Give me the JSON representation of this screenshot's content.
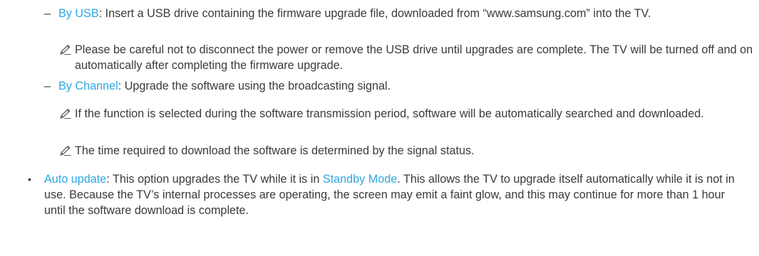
{
  "usb": {
    "dash": "–",
    "link": "By USB",
    "text": ": Insert a USB drive containing the firmware upgrade file, downloaded from “www.samsung.com” into the TV."
  },
  "notes": [
    "Please be careful not to disconnect the power or remove the USB drive until upgrades are complete. The TV will be turned off and on automatically after completing the firmware upgrade.",
    "If the function is selected during the software transmission period, software will be automatically searched and downloaded.",
    "The time required to download the software is determined by the signal status."
  ],
  "channel": {
    "dash": "–",
    "link": "By Channel",
    "text": ": Upgrade the software using the broadcasting signal."
  },
  "auto": {
    "bullet": "•",
    "link": "Auto update",
    "text_1": ": This option upgrades the TV while it is in ",
    "link_2": "Standby Mode",
    "text_2": ". This allows the TV to upgrade itself automatically while it is not in use. Because the TV’s internal processes are operating, the screen may emit a faint glow, and this may continue for more than 1 hour until the software download is complete."
  },
  "colors": {
    "link": "#2ea6e0",
    "body_text": "#3a3a3a"
  },
  "icons": {
    "note": "pencil-icon"
  }
}
